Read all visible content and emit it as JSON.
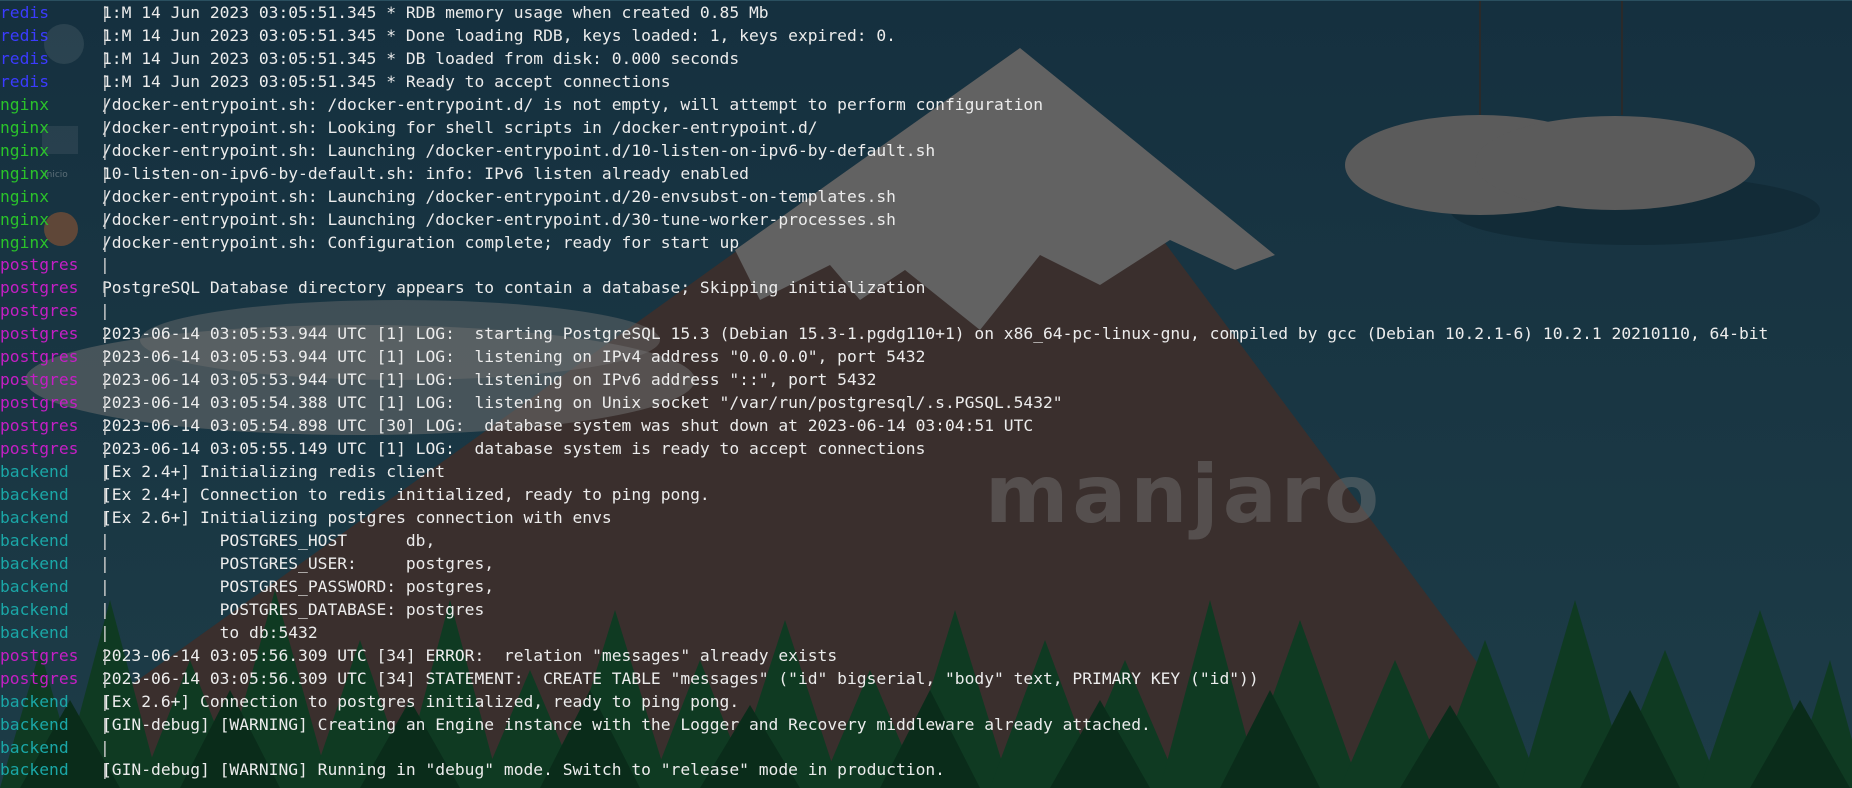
{
  "wallpaper": {
    "logo_text": "manjaro"
  },
  "desktop": {
    "icons": [
      {
        "name": "home-folder-icon",
        "label": "Inicio"
      },
      {
        "name": "firefox-icon",
        "label": ""
      },
      {
        "name": "settings-icon",
        "label": ""
      }
    ]
  },
  "terminal": {
    "separator": "|",
    "lines": [
      {
        "service": "redis",
        "text": "1:M 14 Jun 2023 03:05:51.345 * RDB memory usage when created 0.85 Mb"
      },
      {
        "service": "redis",
        "text": "1:M 14 Jun 2023 03:05:51.345 * Done loading RDB, keys loaded: 1, keys expired: 0."
      },
      {
        "service": "redis",
        "text": "1:M 14 Jun 2023 03:05:51.345 * DB loaded from disk: 0.000 seconds"
      },
      {
        "service": "redis",
        "text": "1:M 14 Jun 2023 03:05:51.345 * Ready to accept connections"
      },
      {
        "service": "nginx",
        "text": "/docker-entrypoint.sh: /docker-entrypoint.d/ is not empty, will attempt to perform configuration"
      },
      {
        "service": "nginx",
        "text": "/docker-entrypoint.sh: Looking for shell scripts in /docker-entrypoint.d/"
      },
      {
        "service": "nginx",
        "text": "/docker-entrypoint.sh: Launching /docker-entrypoint.d/10-listen-on-ipv6-by-default.sh"
      },
      {
        "service": "nginx",
        "text": "10-listen-on-ipv6-by-default.sh: info: IPv6 listen already enabled"
      },
      {
        "service": "nginx",
        "text": "/docker-entrypoint.sh: Launching /docker-entrypoint.d/20-envsubst-on-templates.sh"
      },
      {
        "service": "nginx",
        "text": "/docker-entrypoint.sh: Launching /docker-entrypoint.d/30-tune-worker-processes.sh"
      },
      {
        "service": "nginx",
        "text": "/docker-entrypoint.sh: Configuration complete; ready for start up"
      },
      {
        "service": "postgres",
        "text": ""
      },
      {
        "service": "postgres",
        "text": "PostgreSQL Database directory appears to contain a database; Skipping initialization"
      },
      {
        "service": "postgres",
        "text": ""
      },
      {
        "service": "postgres",
        "text": "2023-06-14 03:05:53.944 UTC [1] LOG:  starting PostgreSQL 15.3 (Debian 15.3-1.pgdg110+1) on x86_64-pc-linux-gnu, compiled by gcc (Debian 10.2.1-6) 10.2.1 20210110, 64-bit"
      },
      {
        "service": "postgres",
        "text": "2023-06-14 03:05:53.944 UTC [1] LOG:  listening on IPv4 address \"0.0.0.0\", port 5432"
      },
      {
        "service": "postgres",
        "text": "2023-06-14 03:05:53.944 UTC [1] LOG:  listening on IPv6 address \"::\", port 5432"
      },
      {
        "service": "postgres",
        "text": "2023-06-14 03:05:54.388 UTC [1] LOG:  listening on Unix socket \"/var/run/postgresql/.s.PGSQL.5432\""
      },
      {
        "service": "postgres",
        "text": "2023-06-14 03:05:54.898 UTC [30] LOG:  database system was shut down at 2023-06-14 03:04:51 UTC"
      },
      {
        "service": "postgres",
        "text": "2023-06-14 03:05:55.149 UTC [1] LOG:  database system is ready to accept connections"
      },
      {
        "service": "backend",
        "text": "[Ex 2.4+] Initializing redis client"
      },
      {
        "service": "backend",
        "text": "[Ex 2.4+] Connection to redis initialized, ready to ping pong."
      },
      {
        "service": "backend",
        "text": "[Ex 2.6+] Initializing postgres connection with envs"
      },
      {
        "service": "backend",
        "text": "            POSTGRES_HOST      db,"
      },
      {
        "service": "backend",
        "text": "            POSTGRES_USER:     postgres,"
      },
      {
        "service": "backend",
        "text": "            POSTGRES_PASSWORD: postgres,"
      },
      {
        "service": "backend",
        "text": "            POSTGRES_DATABASE: postgres"
      },
      {
        "service": "backend",
        "text": "            to db:5432"
      },
      {
        "service": "postgres",
        "text": "2023-06-14 03:05:56.309 UTC [34] ERROR:  relation \"messages\" already exists"
      },
      {
        "service": "postgres",
        "text": "2023-06-14 03:05:56.309 UTC [34] STATEMENT:  CREATE TABLE \"messages\" (\"id\" bigserial, \"body\" text, PRIMARY KEY (\"id\"))"
      },
      {
        "service": "backend",
        "text": "[Ex 2.6+] Connection to postgres initialized, ready to ping pong."
      },
      {
        "service": "backend",
        "text": "[GIN-debug] [WARNING] Creating an Engine instance with the Logger and Recovery middleware already attached."
      },
      {
        "service": "backend",
        "text": ""
      },
      {
        "service": "backend",
        "text": "[GIN-debug] [WARNING] Running in \"debug\" mode. Switch to \"release\" mode in production."
      }
    ]
  },
  "colors": {
    "background": "#173240",
    "redis": "#3b3bff",
    "nginx": "#2ac32a",
    "postgres": "#c51fc5",
    "backend": "#1aa7a7",
    "text": "#ececec",
    "mountain": "#3a2f2d",
    "snow": "#616161",
    "trees": "#0f3a22"
  }
}
